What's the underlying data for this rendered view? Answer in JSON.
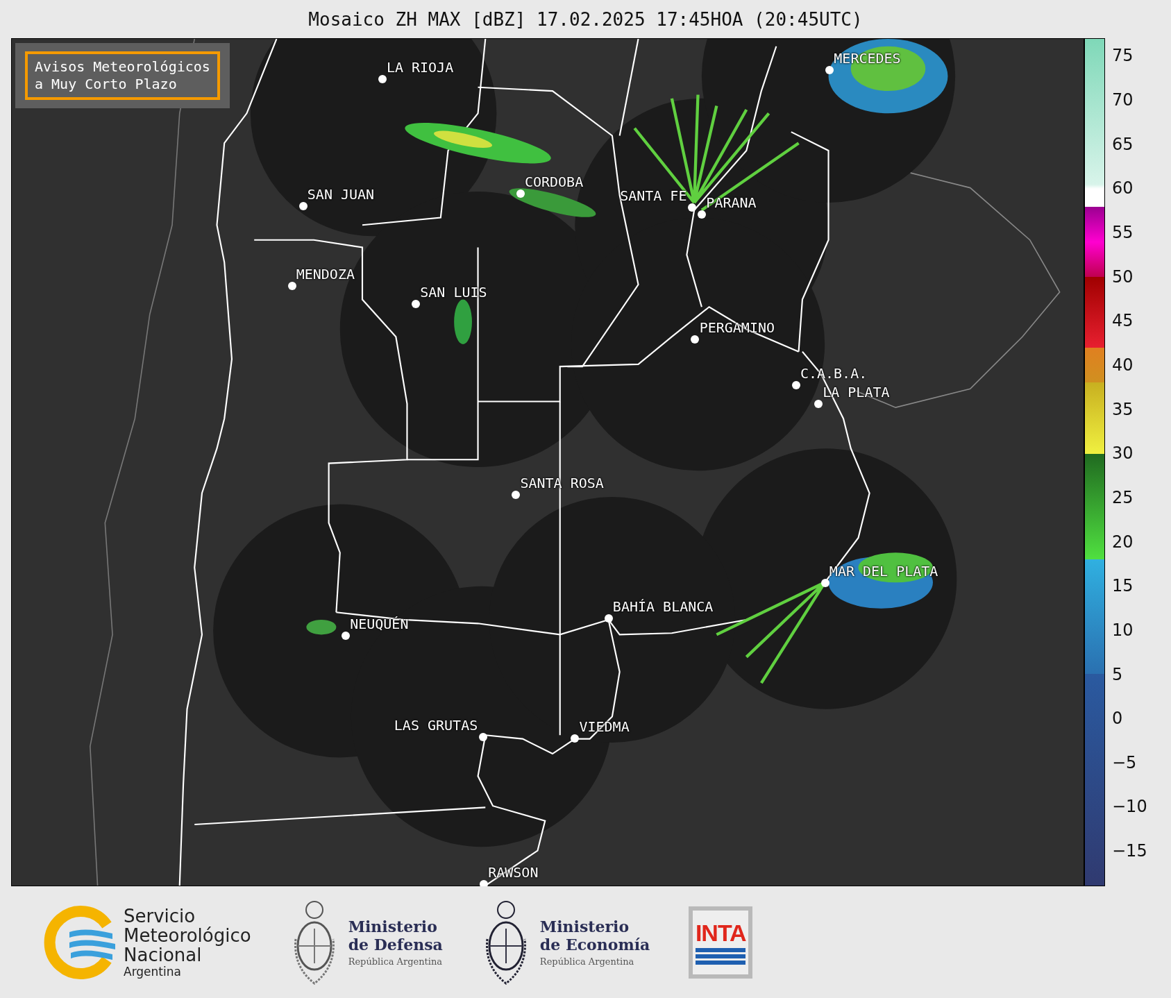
{
  "title": "Mosaico ZH MAX [dBZ] 17.02.2025 17:45HOA (20:45UTC)",
  "warning_box": {
    "text": "Avisos Meteorológicos\na Muy Corto Plazo"
  },
  "cities": [
    {
      "name": "LA RIOJA"
    },
    {
      "name": "CORDOBA"
    },
    {
      "name": "SAN JUAN"
    },
    {
      "name": "SANTA FE"
    },
    {
      "name": "PARANA"
    },
    {
      "name": "MENDOZA"
    },
    {
      "name": "SAN LUIS"
    },
    {
      "name": "PERGAMINO"
    },
    {
      "name": "MERCEDES"
    },
    {
      "name": "C.A.B.A."
    },
    {
      "name": "LA PLATA"
    },
    {
      "name": "SANTA ROSA"
    },
    {
      "name": "MAR DEL PLATA"
    },
    {
      "name": "BAHÍA BLANCA"
    },
    {
      "name": "NEUQUÉN"
    },
    {
      "name": "LAS GRUTAS"
    },
    {
      "name": "VIEDMA"
    },
    {
      "name": "RAWSON"
    }
  ],
  "colorbar": {
    "ticks": [
      "75",
      "70",
      "65",
      "60",
      "55",
      "50",
      "45",
      "40",
      "35",
      "30",
      "25",
      "20",
      "15",
      "10",
      "5",
      "0",
      "−5",
      "−10",
      "−15"
    ]
  },
  "logos": {
    "smn": {
      "lines": [
        "Servicio",
        "Meteorológico",
        "Nacional"
      ],
      "country": "Argentina"
    },
    "defensa": {
      "lines": [
        "Ministerio",
        "de Defensa"
      ],
      "country": "República Argentina"
    },
    "economia": {
      "lines": [
        "Ministerio",
        "de Economía"
      ],
      "country": "República Argentina"
    },
    "inta": {
      "text": "INTA"
    }
  }
}
